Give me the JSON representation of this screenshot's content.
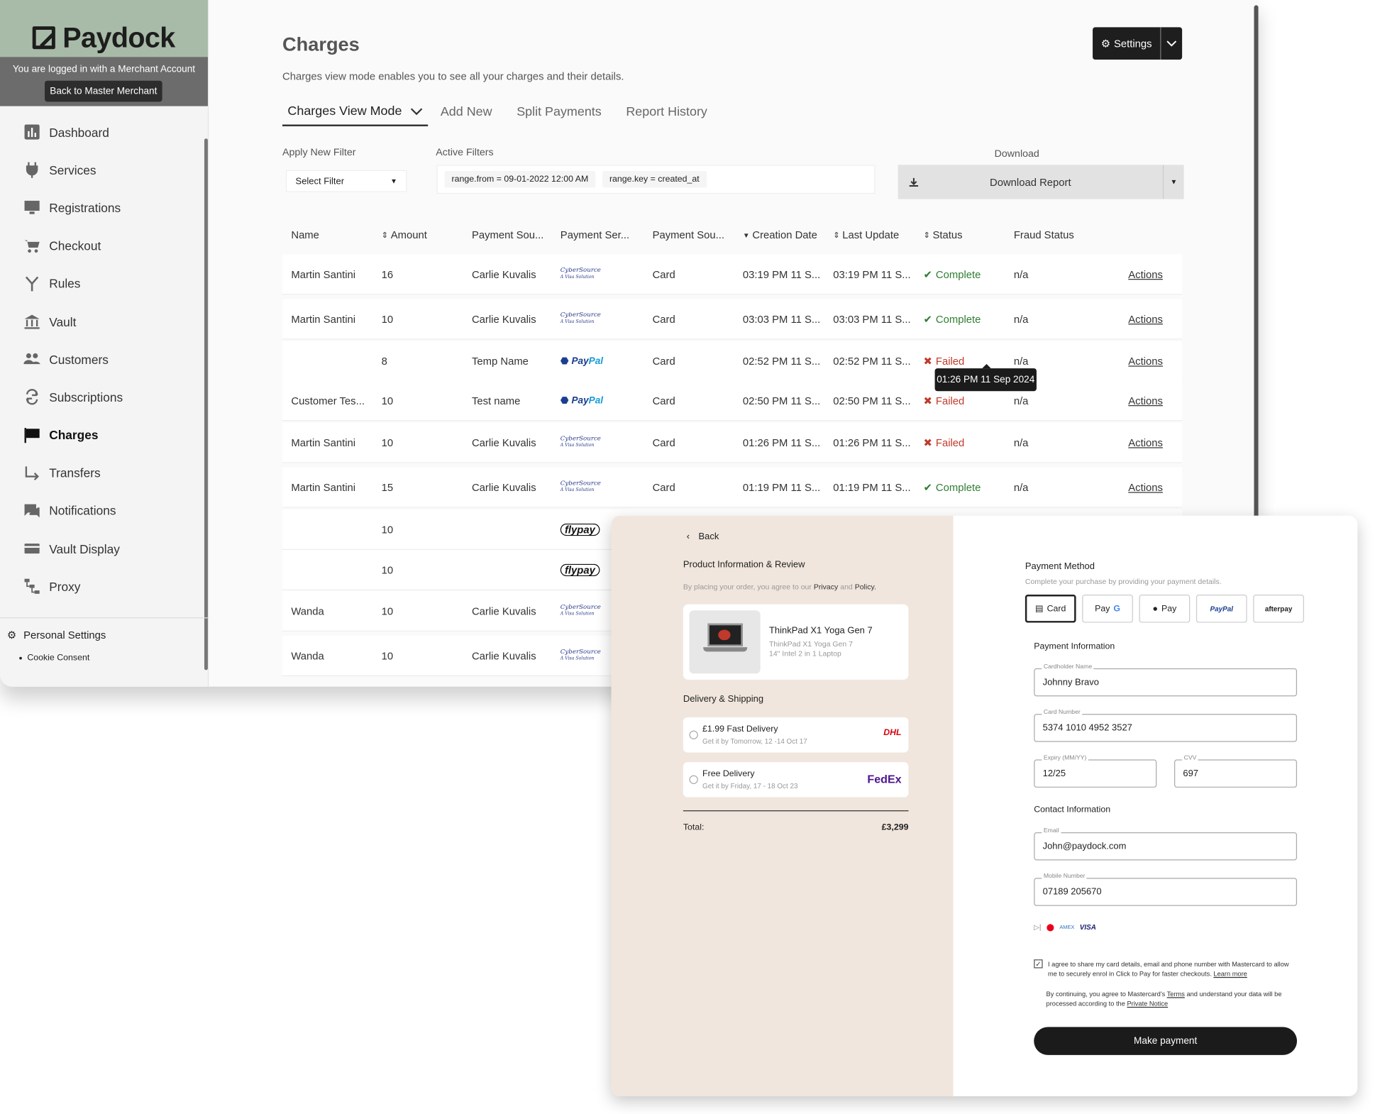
{
  "sidebar": {
    "brand": "Paydock",
    "merchant_notice": "You are logged in with a Merchant Account",
    "back_button": "Back to Master Merchant",
    "items": [
      {
        "label": "Dashboard",
        "icon": "chart-icon"
      },
      {
        "label": "Services",
        "icon": "plug-icon"
      },
      {
        "label": "Registrations",
        "icon": "monitor-icon"
      },
      {
        "label": "Checkout",
        "icon": "cart-icon"
      },
      {
        "label": "Rules",
        "icon": "fork-icon"
      },
      {
        "label": "Vault",
        "icon": "bank-icon"
      },
      {
        "label": "Customers",
        "icon": "users-icon"
      },
      {
        "label": "Subscriptions",
        "icon": "refresh-icon"
      },
      {
        "label": "Charges",
        "icon": "flag-icon",
        "active": true
      },
      {
        "label": "Transfers",
        "icon": "arrow-icon"
      },
      {
        "label": "Notifications",
        "icon": "chat-icon"
      },
      {
        "label": "Vault Display",
        "icon": "card-icon"
      },
      {
        "label": "Proxy",
        "icon": "hierarchy-icon"
      }
    ],
    "personal_settings": "Personal Settings",
    "cookie_consent": "Cookie Consent"
  },
  "header": {
    "title": "Charges",
    "description": "Charges view mode enables you to see all your charges and their details.",
    "settings_label": "Settings"
  },
  "tabs": [
    {
      "label": "Charges View Mode",
      "active": true
    },
    {
      "label": "Add New"
    },
    {
      "label": "Split Payments"
    },
    {
      "label": "Report History"
    }
  ],
  "filters": {
    "apply_label": "Apply New Filter",
    "select_placeholder": "Select Filter",
    "active_label": "Active Filters",
    "chips": [
      "range.from = 09-01-2022 12:00 AM",
      "range.key = created_at"
    ],
    "download_label": "Download",
    "download_button": "Download Report"
  },
  "table": {
    "columns": [
      {
        "label": "Name",
        "sort": ""
      },
      {
        "label": "Amount",
        "sort": "both"
      },
      {
        "label": "Payment Sou...",
        "sort": ""
      },
      {
        "label": "Payment Ser...",
        "sort": ""
      },
      {
        "label": "Payment Sou...",
        "sort": ""
      },
      {
        "label": "Creation Date",
        "sort": "down"
      },
      {
        "label": "Last Update",
        "sort": "both"
      },
      {
        "label": "Status",
        "sort": "both"
      },
      {
        "label": "Fraud Status",
        "sort": ""
      }
    ],
    "rows": [
      {
        "name": "Martin Santini",
        "amount": "16",
        "source": "Carlie Kuvalis",
        "service": "cybersource",
        "type": "Card",
        "created": "03:19 PM 11 S...",
        "updated": "03:19 PM 11 S...",
        "status": "Complete",
        "fraud": "n/a",
        "action": "Actions"
      },
      {
        "name": "Martin Santini",
        "amount": "10",
        "source": "Carlie Kuvalis",
        "service": "cybersource",
        "type": "Card",
        "created": "03:03 PM 11 S...",
        "updated": "03:03 PM 11 S...",
        "status": "Complete",
        "fraud": "n/a",
        "action": "Actions"
      },
      {
        "name": "",
        "amount": "8",
        "source": "Temp Name",
        "service": "paypal",
        "type": "Card",
        "created": "02:52 PM 11 S...",
        "updated": "02:52 PM 11 S...",
        "status": "Failed",
        "fraud": "n/a",
        "action": "Actions"
      },
      {
        "name": "Customer Tes...",
        "amount": "10",
        "source": "Test name",
        "service": "paypal",
        "type": "Card",
        "created": "02:50 PM 11 S...",
        "updated": "02:50 PM 11 S...",
        "status": "Failed",
        "fraud": "n/a",
        "action": "Actions"
      },
      {
        "name": "Martin Santini",
        "amount": "10",
        "source": "Carlie Kuvalis",
        "service": "cybersource",
        "type": "Card",
        "created": "01:26 PM 11 S...",
        "updated": "01:26 PM 11 S...",
        "status": "Failed",
        "fraud": "n/a",
        "action": "Actions"
      },
      {
        "name": "Martin Santini",
        "amount": "15",
        "source": "Carlie Kuvalis",
        "service": "cybersource",
        "type": "Card",
        "created": "01:19 PM 11 S...",
        "updated": "01:19 PM 11 S...",
        "status": "Complete",
        "fraud": "n/a",
        "action": "Actions"
      },
      {
        "name": "",
        "amount": "10",
        "source": "",
        "service": "flypay",
        "type": "",
        "created": "",
        "updated": "",
        "status": "",
        "fraud": "",
        "action": ""
      },
      {
        "name": "",
        "amount": "10",
        "source": "",
        "service": "flypay",
        "type": "",
        "created": "",
        "updated": "",
        "status": "",
        "fraud": "",
        "action": ""
      },
      {
        "name": "Wanda",
        "amount": "10",
        "source": "Carlie Kuvalis",
        "service": "cybersource",
        "type": "",
        "created": "",
        "updated": "",
        "status": "",
        "fraud": "",
        "action": ""
      },
      {
        "name": "Wanda",
        "amount": "10",
        "source": "Carlie Kuvalis",
        "service": "cybersource",
        "type": "",
        "created": "",
        "updated": "",
        "status": "",
        "fraud": "",
        "action": ""
      }
    ],
    "tooltip": "01:26 PM 11 Sep 2024"
  },
  "logos": {
    "cybersource": "CyberSource",
    "cybersource_sub": "A Visa Solution",
    "paypal_a": "Pay",
    "paypal_b": "Pal",
    "flypay": "flypay"
  },
  "checkout": {
    "back": "Back",
    "product_section": "Product Information & Review",
    "order_note_pre": "By placing your order, you agree to our",
    "order_note_privacy": "Privacy",
    "order_note_and": "and",
    "order_note_policy": "Policy.",
    "product_name": "ThinkPad X1 Yoga Gen 7",
    "product_sub1": "ThinkPad X1 Yoga Gen 7",
    "product_sub2": "14\" Intel 2 in 1 Laptop",
    "delivery_section": "Delivery & Shipping",
    "options": [
      {
        "name": "£1.99 Fast Delivery",
        "sub": "Get it by Tomorrow, 12 -14 Oct 17",
        "carrier": "DHL"
      },
      {
        "name": "Free Delivery",
        "sub": "Get it by Friday, 17 - 18 Oct 23",
        "carrier": "FedEx"
      }
    ],
    "total_label": "Total:",
    "total_value": "£3,299",
    "payment_method": "Payment Method",
    "payment_method_sub": "Complete your purchase by providing your payment details.",
    "methods": [
      "Card",
      "Pay",
      "Pay",
      "PayPal",
      "afterpay"
    ],
    "payment_info": "Payment Information",
    "cardholder_label": "Cardholder Name",
    "cardholder": "Johnny Bravo",
    "card_number_label": "Card Number",
    "card_number": "5374 1010 4952 3527",
    "expiry_label": "Expiry (MM/YY)",
    "expiry": "12/25",
    "cvv_label": "CVV",
    "cvv": "697",
    "contact_info": "Contact Information",
    "email_label": "Email",
    "email": "John@paydock.com",
    "mobile_label": "Mobile Number",
    "mobile": "07189 205670",
    "visa": "VISA",
    "consent": "I agree to share my card details, email and phone number with Mastercard to allow me to securely enrol in Click to Pay for faster checkouts.",
    "learn_more": "Learn more",
    "terms_pre": "By continuing, you agree to Mastercard's",
    "terms_link": "Terms",
    "terms_mid": "and understand your data will be processed according to the",
    "privacy_link": "Private Notice",
    "pay_button": "Make payment"
  },
  "colors": {
    "brand_band": "#a8bba8",
    "checkout_left_bg": "#f0e6dd",
    "status_complete": "#2e7d32",
    "status_failed": "#c0392b"
  }
}
